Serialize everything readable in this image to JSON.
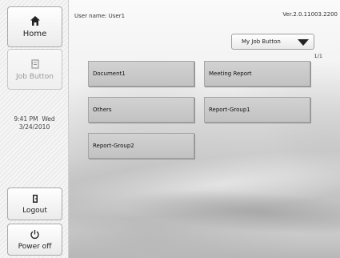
{
  "sidebar": {
    "home": {
      "label": "Home",
      "icon": "home-icon"
    },
    "job_button": {
      "label": "Job Button",
      "icon": "job-button-icon"
    },
    "clock": {
      "time": "9:41 PM",
      "day": "Wed",
      "date": "3/24/2010"
    },
    "logout": {
      "label": "Logout",
      "icon": "logout-icon"
    },
    "power_off": {
      "label": "Power off",
      "icon": "power-icon"
    }
  },
  "header": {
    "user_name": "User name: User1",
    "version": "Ver.2.0.11003.2200"
  },
  "dropdown": {
    "selected": "My Job Button"
  },
  "page_indicator": "1/1",
  "job_buttons": [
    {
      "label": "Document1"
    },
    {
      "label": "Meeting Report"
    },
    {
      "label": "Others"
    },
    {
      "label": "Report-Group1"
    },
    {
      "label": "Report-Group2"
    }
  ]
}
